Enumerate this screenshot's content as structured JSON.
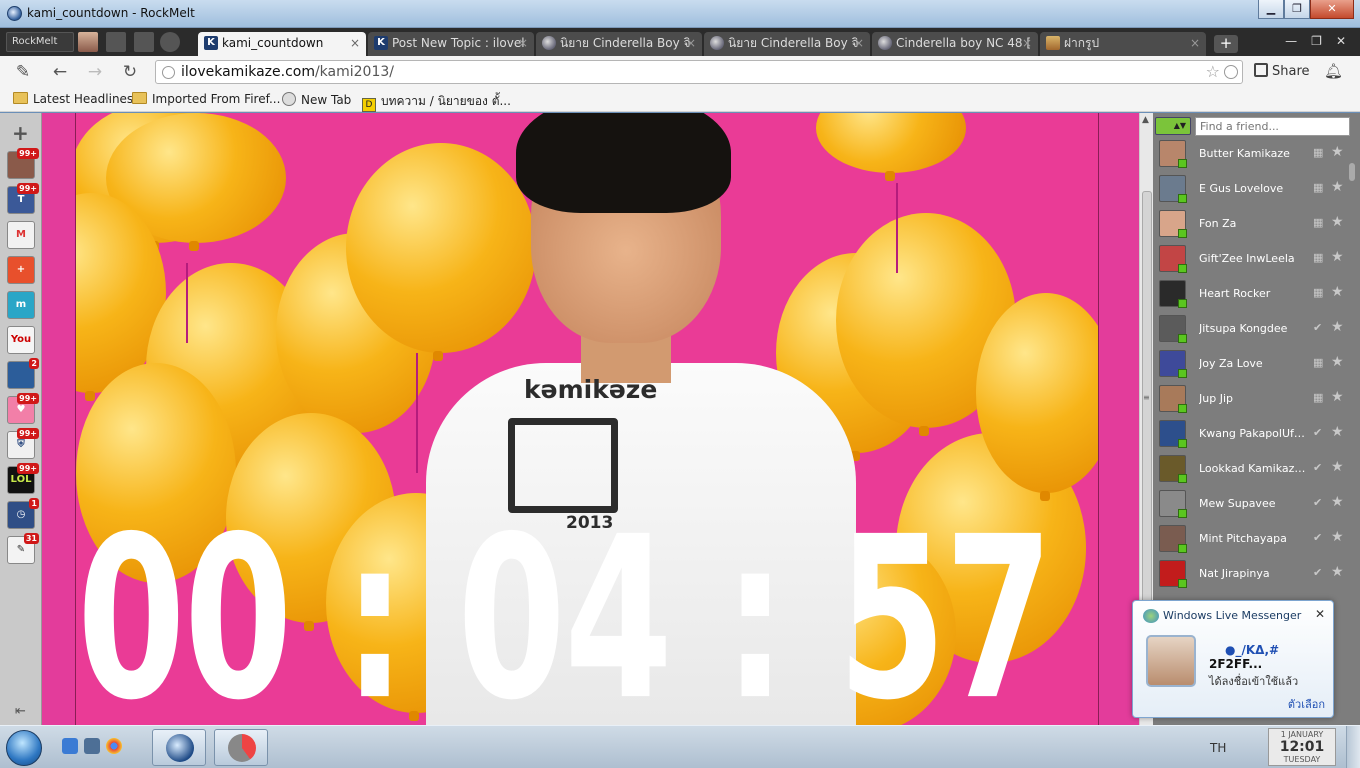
{
  "window": {
    "title": "kami_countdown - RockMelt",
    "min": "▁",
    "max": "❐",
    "close": "✕"
  },
  "tabstrip": {
    "menu_label": "RockMelt",
    "tabs": [
      {
        "label": "kami_countdown",
        "icon": "kamikaze-icon",
        "active": true
      },
      {
        "label": "Post New Topic : ilovel",
        "icon": "kamikaze-icon",
        "active": false
      },
      {
        "label": "นิยาย Cinderella Boy จิ",
        "icon": "globe-icon",
        "active": false
      },
      {
        "label": "นิยาย Cinderella Boy จิ",
        "icon": "globe-icon",
        "active": false
      },
      {
        "label": "Cinderella boy NC 48 [",
        "icon": "globe-icon",
        "active": false
      },
      {
        "label": "ฝากรูป",
        "icon": "image-icon",
        "active": false
      }
    ],
    "tab_close": "×",
    "new_tab": "+",
    "strip_min": "—",
    "strip_max": "❐",
    "strip_close": "✕"
  },
  "toolbar": {
    "url_host": "ilovekamikaze.com",
    "url_path": "/kami2013/",
    "share_label": "Share"
  },
  "bookmarks": [
    {
      "label": "Latest Headlines",
      "icon": "folder-icon"
    },
    {
      "label": "Imported From Firef...",
      "icon": "folder-icon"
    },
    {
      "label": "New Tab",
      "icon": "globe-icon"
    },
    {
      "label": "บทความ / นิยายของ ตั้...",
      "icon": "pen-icon"
    }
  ],
  "apps": [
    {
      "name": "app-profile",
      "badge": "99+",
      "color": "#8a5a4a",
      "glyph": ""
    },
    {
      "name": "app-facebook",
      "badge": "99+",
      "color": "#3b5998",
      "glyph": "T"
    },
    {
      "name": "app-gmail",
      "badge": "",
      "color": "#f2f2f2",
      "glyph": "M"
    },
    {
      "name": "app-google-plus",
      "badge": "",
      "color": "#e8502c",
      "glyph": "+"
    },
    {
      "name": "app-myspace",
      "badge": "",
      "color": "#2aa6c7",
      "glyph": "m"
    },
    {
      "name": "app-youtube",
      "badge": "",
      "color": "#f5f5f5",
      "glyph": "You"
    },
    {
      "name": "app-globe",
      "badge": "2",
      "color": "#2c5d9a",
      "glyph": ""
    },
    {
      "name": "app-heart",
      "badge": "99+",
      "color": "#f27fa8",
      "glyph": "♥"
    },
    {
      "name": "app-shield",
      "badge": "99+",
      "color": "#f1f1f1",
      "glyph": "⛨"
    },
    {
      "name": "app-lol",
      "badge": "99+",
      "color": "#111",
      "glyph": "LOL"
    },
    {
      "name": "app-clock",
      "badge": "1",
      "color": "#2f4e86",
      "glyph": "◷"
    },
    {
      "name": "app-notes",
      "badge": "31",
      "color": "#f3f3f3",
      "glyph": "✎"
    }
  ],
  "countdown": {
    "hours": "00",
    "minutes": "04",
    "seconds": "57",
    "separator": ":"
  },
  "shirt": {
    "brand": "kəmikəze",
    "year": "2013"
  },
  "friends": {
    "search_placeholder": "Find a friend...",
    "list": [
      {
        "name": "Butter Kamikaze",
        "action": "gift",
        "color": "#b8866b"
      },
      {
        "name": "E Gus Lovelove",
        "action": "gift",
        "color": "#6b7b8e"
      },
      {
        "name": "Fon Za",
        "action": "gift",
        "color": "#d8a58a"
      },
      {
        "name": "Gift'Zee InwLeela",
        "action": "gift",
        "color": "#c24545"
      },
      {
        "name": "Heart Rocker",
        "action": "gift",
        "color": "#2a2a2a"
      },
      {
        "name": "Jitsupa Kongdee",
        "action": "check",
        "color": "#5b5b5b"
      },
      {
        "name": "Joy Za Love",
        "action": "gift",
        "color": "#3e4a9a"
      },
      {
        "name": "Jup Jip",
        "action": "gift",
        "color": "#a87a5a"
      },
      {
        "name": "Kwang PakapolUfo...",
        "action": "check",
        "color": "#2d4f8c"
      },
      {
        "name": "Lookkad Kamikaze ...",
        "action": "check",
        "color": "#6a5a2a"
      },
      {
        "name": "Mew Supavee",
        "action": "check",
        "color": "#8a8a8a"
      },
      {
        "name": "Mint Pitchayapa",
        "action": "check",
        "color": "#7a5c50"
      },
      {
        "name": "Nat Jirapinya",
        "action": "check",
        "color": "#c21c1c"
      }
    ]
  },
  "wlm": {
    "title": "Windows Live Messenger",
    "line1": "●_/KΔ,#",
    "line2": "2F2FF...",
    "line3": "ได้ลงชื่อเข้าใช้แล้ว",
    "options": "ตัวเลือก",
    "close": "✕"
  },
  "taskbar": {
    "language": "TH",
    "clock_date": "1 JANUARY",
    "clock_time": "12:01",
    "clock_day": "TUESDAY"
  }
}
